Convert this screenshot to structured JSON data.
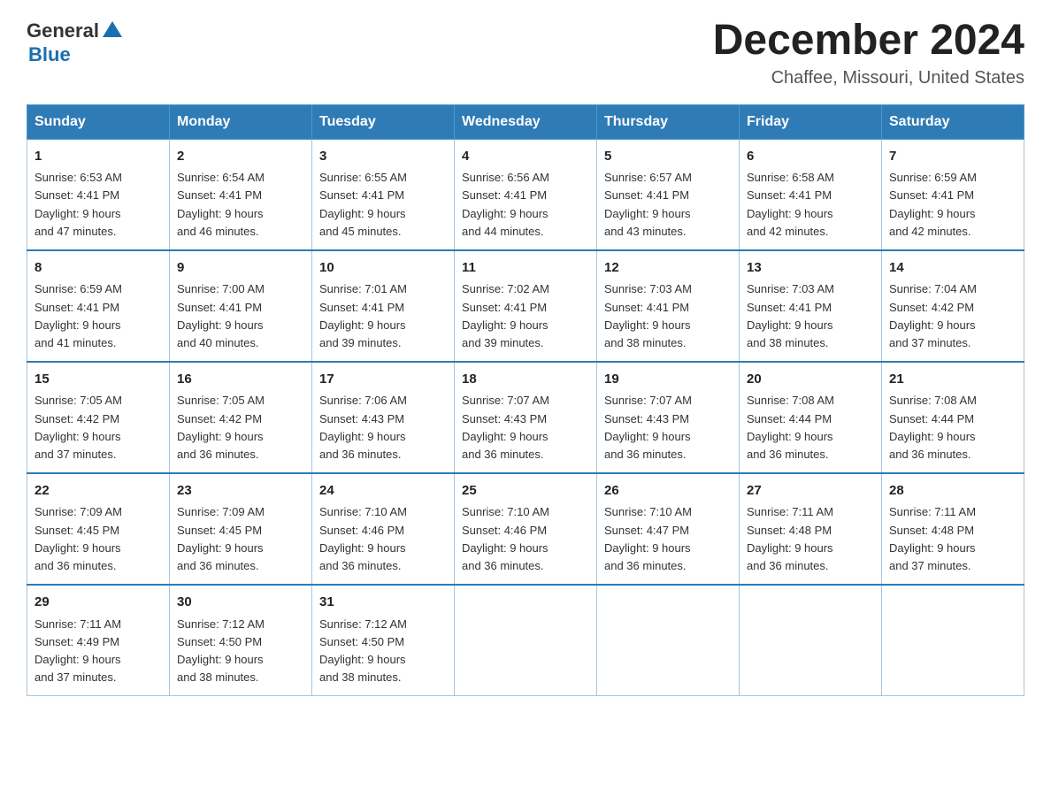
{
  "header": {
    "logo_general": "General",
    "logo_blue": "Blue",
    "month_title": "December 2024",
    "location": "Chaffee, Missouri, United States"
  },
  "weekdays": [
    "Sunday",
    "Monday",
    "Tuesday",
    "Wednesday",
    "Thursday",
    "Friday",
    "Saturday"
  ],
  "weeks": [
    [
      {
        "day": "1",
        "sunrise": "6:53 AM",
        "sunset": "4:41 PM",
        "daylight": "9 hours and 47 minutes."
      },
      {
        "day": "2",
        "sunrise": "6:54 AM",
        "sunset": "4:41 PM",
        "daylight": "9 hours and 46 minutes."
      },
      {
        "day": "3",
        "sunrise": "6:55 AM",
        "sunset": "4:41 PM",
        "daylight": "9 hours and 45 minutes."
      },
      {
        "day": "4",
        "sunrise": "6:56 AM",
        "sunset": "4:41 PM",
        "daylight": "9 hours and 44 minutes."
      },
      {
        "day": "5",
        "sunrise": "6:57 AM",
        "sunset": "4:41 PM",
        "daylight": "9 hours and 43 minutes."
      },
      {
        "day": "6",
        "sunrise": "6:58 AM",
        "sunset": "4:41 PM",
        "daylight": "9 hours and 42 minutes."
      },
      {
        "day": "7",
        "sunrise": "6:59 AM",
        "sunset": "4:41 PM",
        "daylight": "9 hours and 42 minutes."
      }
    ],
    [
      {
        "day": "8",
        "sunrise": "6:59 AM",
        "sunset": "4:41 PM",
        "daylight": "9 hours and 41 minutes."
      },
      {
        "day": "9",
        "sunrise": "7:00 AM",
        "sunset": "4:41 PM",
        "daylight": "9 hours and 40 minutes."
      },
      {
        "day": "10",
        "sunrise": "7:01 AM",
        "sunset": "4:41 PM",
        "daylight": "9 hours and 39 minutes."
      },
      {
        "day": "11",
        "sunrise": "7:02 AM",
        "sunset": "4:41 PM",
        "daylight": "9 hours and 39 minutes."
      },
      {
        "day": "12",
        "sunrise": "7:03 AM",
        "sunset": "4:41 PM",
        "daylight": "9 hours and 38 minutes."
      },
      {
        "day": "13",
        "sunrise": "7:03 AM",
        "sunset": "4:41 PM",
        "daylight": "9 hours and 38 minutes."
      },
      {
        "day": "14",
        "sunrise": "7:04 AM",
        "sunset": "4:42 PM",
        "daylight": "9 hours and 37 minutes."
      }
    ],
    [
      {
        "day": "15",
        "sunrise": "7:05 AM",
        "sunset": "4:42 PM",
        "daylight": "9 hours and 37 minutes."
      },
      {
        "day": "16",
        "sunrise": "7:05 AM",
        "sunset": "4:42 PM",
        "daylight": "9 hours and 36 minutes."
      },
      {
        "day": "17",
        "sunrise": "7:06 AM",
        "sunset": "4:43 PM",
        "daylight": "9 hours and 36 minutes."
      },
      {
        "day": "18",
        "sunrise": "7:07 AM",
        "sunset": "4:43 PM",
        "daylight": "9 hours and 36 minutes."
      },
      {
        "day": "19",
        "sunrise": "7:07 AM",
        "sunset": "4:43 PM",
        "daylight": "9 hours and 36 minutes."
      },
      {
        "day": "20",
        "sunrise": "7:08 AM",
        "sunset": "4:44 PM",
        "daylight": "9 hours and 36 minutes."
      },
      {
        "day": "21",
        "sunrise": "7:08 AM",
        "sunset": "4:44 PM",
        "daylight": "9 hours and 36 minutes."
      }
    ],
    [
      {
        "day": "22",
        "sunrise": "7:09 AM",
        "sunset": "4:45 PM",
        "daylight": "9 hours and 36 minutes."
      },
      {
        "day": "23",
        "sunrise": "7:09 AM",
        "sunset": "4:45 PM",
        "daylight": "9 hours and 36 minutes."
      },
      {
        "day": "24",
        "sunrise": "7:10 AM",
        "sunset": "4:46 PM",
        "daylight": "9 hours and 36 minutes."
      },
      {
        "day": "25",
        "sunrise": "7:10 AM",
        "sunset": "4:46 PM",
        "daylight": "9 hours and 36 minutes."
      },
      {
        "day": "26",
        "sunrise": "7:10 AM",
        "sunset": "4:47 PM",
        "daylight": "9 hours and 36 minutes."
      },
      {
        "day": "27",
        "sunrise": "7:11 AM",
        "sunset": "4:48 PM",
        "daylight": "9 hours and 36 minutes."
      },
      {
        "day": "28",
        "sunrise": "7:11 AM",
        "sunset": "4:48 PM",
        "daylight": "9 hours and 37 minutes."
      }
    ],
    [
      {
        "day": "29",
        "sunrise": "7:11 AM",
        "sunset": "4:49 PM",
        "daylight": "9 hours and 37 minutes."
      },
      {
        "day": "30",
        "sunrise": "7:12 AM",
        "sunset": "4:50 PM",
        "daylight": "9 hours and 38 minutes."
      },
      {
        "day": "31",
        "sunrise": "7:12 AM",
        "sunset": "4:50 PM",
        "daylight": "9 hours and 38 minutes."
      },
      null,
      null,
      null,
      null
    ]
  ],
  "labels": {
    "sunrise": "Sunrise:",
    "sunset": "Sunset:",
    "daylight": "Daylight:"
  }
}
